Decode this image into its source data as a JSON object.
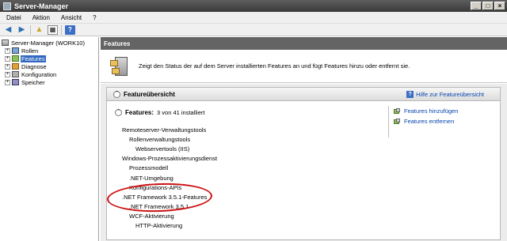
{
  "window": {
    "title": "Server-Manager",
    "buttons": [
      "_",
      "□",
      "×"
    ]
  },
  "menu": {
    "items": [
      "Datei",
      "Aktion",
      "Ansicht",
      "?"
    ]
  },
  "toolbar": {
    "icons": [
      "back-icon",
      "forward-icon",
      "folder-up-icon",
      "properties-icon",
      "help-icon"
    ]
  },
  "tree": {
    "root": "Server-Manager (WORK10)",
    "items": [
      {
        "label": "Rollen",
        "expander": "+",
        "selected": false
      },
      {
        "label": "Features",
        "expander": "+",
        "selected": true
      },
      {
        "label": "Diagnose",
        "expander": "+",
        "selected": false
      },
      {
        "label": "Konfiguration",
        "expander": "+",
        "selected": false
      },
      {
        "label": "Speicher",
        "expander": "+",
        "selected": false
      }
    ]
  },
  "main": {
    "header": "Features",
    "banner_text": "Zeigt den Status der auf dem Server installierten Features an und fügt Features hinzu oder entfernt sie.",
    "section": {
      "title": "Featureübersicht",
      "help_link": "Hilfe zur Featureübersicht",
      "summary_label": "Features:",
      "summary_value": "3 von 41 installiert",
      "features": [
        {
          "label": "Remoteserver-Verwaltungstools",
          "level": 0
        },
        {
          "label": "Rollenverwaltungstools",
          "level": 1
        },
        {
          "label": "Webservertools (IIS)",
          "level": 2
        },
        {
          "label": "Windows-Prozessaktivierungsdienst",
          "level": 0
        },
        {
          "label": "Prozessmodell",
          "level": 1
        },
        {
          "label": ".NET-Umgebung",
          "level": 1
        },
        {
          "label": "Konfigurations-APIs",
          "level": 1
        },
        {
          "label": ".NET Framework 3.5.1-Features",
          "level": 0
        },
        {
          "label": ".NET Framework 3.5.1",
          "level": 1
        },
        {
          "label": "WCF-Aktivierung",
          "level": 1
        },
        {
          "label": "HTTP-Aktivierung",
          "level": 2
        }
      ],
      "actions": [
        "Features hinzufügen",
        "Features entfernen"
      ]
    }
  },
  "colors": {
    "selection": "#3168c0",
    "header": "#646464",
    "link": "#0645ad",
    "annotation": "#cc1111"
  }
}
